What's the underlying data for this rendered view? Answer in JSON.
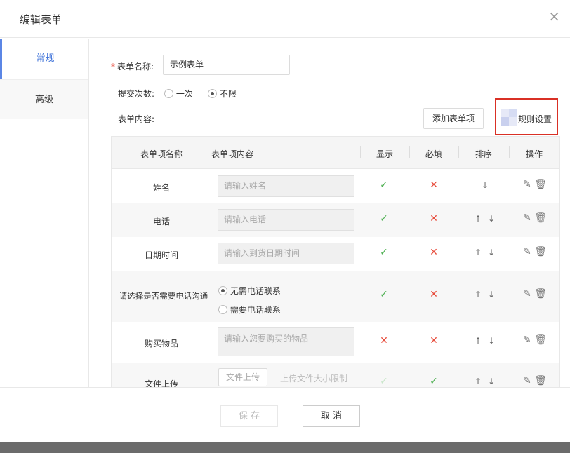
{
  "header": {
    "title": "编辑表单",
    "close": "×"
  },
  "sidebar": {
    "items": [
      {
        "label": "常规"
      },
      {
        "label": "高级"
      }
    ]
  },
  "form": {
    "name_label": "表单名称:",
    "name_value": "示例表单",
    "submit_label": "提交次数:",
    "submit_options": [
      {
        "label": "一次",
        "selected": false
      },
      {
        "label": "不限",
        "selected": true
      }
    ],
    "content_label": "表单内容:",
    "add_item_button": "添加表单项",
    "rule_button": "规则设置"
  },
  "table": {
    "headers": [
      "表单项名称",
      "表单项内容",
      "显示",
      "必填",
      "排序",
      "操作"
    ],
    "rows": [
      {
        "name": "姓名",
        "content": "请输入姓名",
        "show": true,
        "required": false,
        "up": false,
        "down": true
      },
      {
        "name": "电话",
        "content": "请输入电话",
        "show": true,
        "required": false,
        "up": true,
        "down": true
      },
      {
        "name": "日期时间",
        "content": "请输入到货日期时间",
        "show": true,
        "required": false,
        "up": true,
        "down": true
      },
      {
        "name": "请选择是否需要电话沟通",
        "options": [
          {
            "label": "无需电话联系",
            "selected": true
          },
          {
            "label": "需要电话联系",
            "selected": false
          }
        ],
        "show": true,
        "required": false,
        "up": true,
        "down": true
      },
      {
        "name": "购买物品",
        "content": "请输入您要购买的物品",
        "show": false,
        "required": false,
        "up": true,
        "down": true
      },
      {
        "name": "文件上传",
        "upload_button": "文件上传",
        "upload_hint": "上传文件大小限制",
        "show": true,
        "required": true,
        "up": true,
        "down": true
      }
    ]
  },
  "footer": {
    "save": "保 存",
    "cancel": "取 消"
  },
  "colors": {
    "accent": "#5b86e5",
    "ok": "#4caf50",
    "error": "#e74c3c",
    "highlight": "#d93025"
  }
}
